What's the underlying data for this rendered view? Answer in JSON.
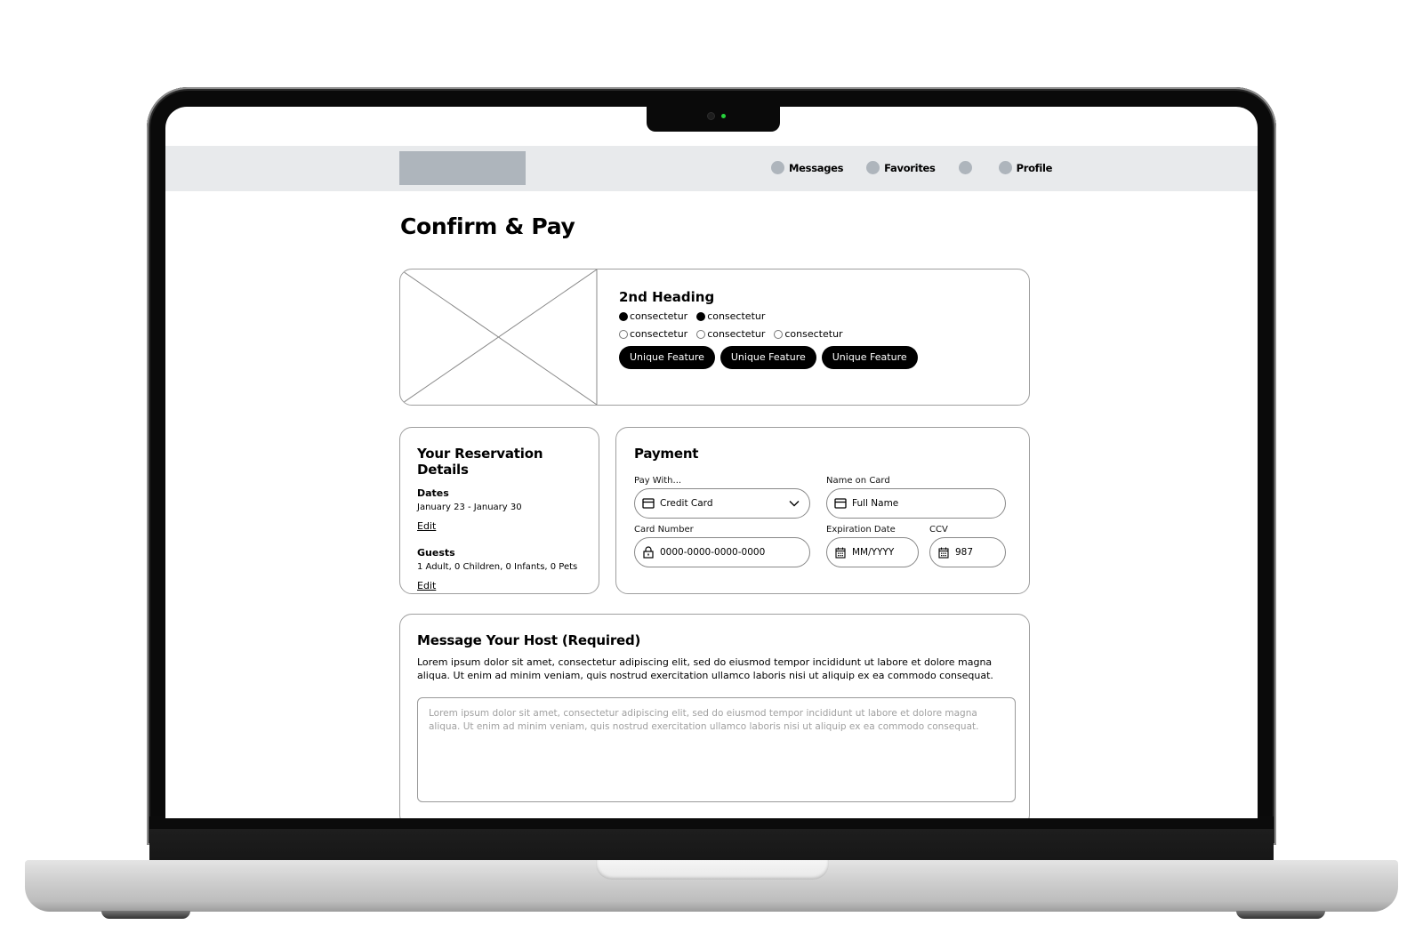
{
  "nav": {
    "items": [
      {
        "label": "Messages",
        "icon": "circle-placeholder-icon"
      },
      {
        "label": "Favorites",
        "icon": "circle-placeholder-icon"
      },
      {
        "label": "",
        "icon": "circle-placeholder-icon"
      },
      {
        "label": "Profile",
        "icon": "circle-placeholder-icon"
      }
    ]
  },
  "page": {
    "title": "Confirm & Pay"
  },
  "listing": {
    "heading": "2nd Heading",
    "tags_filled": [
      "consectetur",
      "consectetur"
    ],
    "tags_empty": [
      "consectetur",
      "consectetur",
      "consectetur"
    ],
    "features": [
      "Unique Feature",
      "Unique Feature",
      "Unique Feature"
    ]
  },
  "reservation": {
    "title": "Your Reservation Details",
    "dates_label": "Dates",
    "dates_value": "January 23 - January 30",
    "guests_label": "Guests",
    "guests_value": "1 Adult, 0 Children, 0 Infants, 0 Pets",
    "edit_label": "Edit"
  },
  "payment": {
    "title": "Payment",
    "pay_with_label": "Pay With...",
    "pay_with_value": "Credit Card",
    "name_label": "Name on Card",
    "name_placeholder": "Full Name",
    "card_number_label": "Card Number",
    "card_number_placeholder": "0000-0000-0000-0000",
    "expiration_label": "Expiration Date",
    "expiration_placeholder": "MM/YYYY",
    "ccv_label": "CCV",
    "ccv_value": "987"
  },
  "message": {
    "title": "Message Your Host (Required)",
    "description": "Lorem ipsum dolor sit amet, consectetur adipiscing elit, sed do eiusmod tempor incididunt ut labore et dolore magna aliqua. Ut enim ad minim veniam, quis nostrud exercitation ullamco laboris nisi ut aliquip ex ea commodo consequat.",
    "placeholder": "Lorem ipsum dolor sit amet, consectetur adipiscing elit, sed do eiusmod tempor incididunt ut labore et dolore magna aliqua. Ut enim ad minim veniam, quis nostrud exercitation ullamco laboris nisi ut aliquip ex ea commodo consequat."
  },
  "colors": {
    "nav_bg": "#e8eaec",
    "placeholder_gray": "#aeb5bc",
    "chip_bg": "#000000",
    "camera_led": "#27d23c"
  }
}
